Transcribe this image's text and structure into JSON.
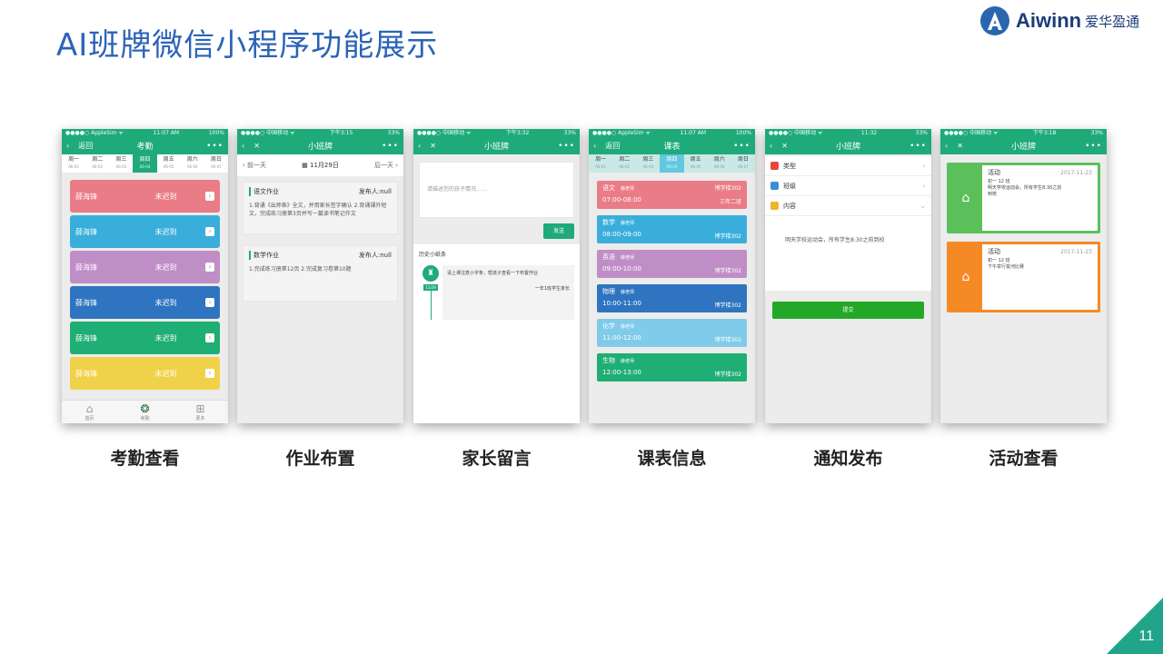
{
  "slide": {
    "title": "AI班牌微信小程序功能展示",
    "page_number": "11",
    "brand_en": "Aiwinn",
    "brand_cn": "爱华盈通"
  },
  "colors": {
    "primary_green": "#1faa7a",
    "title_blue": "#2b63b8"
  },
  "captions": [
    "考勤查看",
    "作业布置",
    "家长留言",
    "课表信息",
    "通知发布",
    "活动查看"
  ],
  "screens": {
    "attendance": {
      "status_left": "●●●●○ AppleSim ᯤ",
      "status_mid": "11:07 AM",
      "status_right": "100%",
      "back": "返回",
      "title": "考勤",
      "more": "•••",
      "days": [
        {
          "label": "周一",
          "date": "06-01"
        },
        {
          "label": "周二",
          "date": "06-02"
        },
        {
          "label": "周三",
          "date": "06-03"
        },
        {
          "label": "周四",
          "date": "06-04"
        },
        {
          "label": "周五",
          "date": "06-05"
        },
        {
          "label": "周六",
          "date": "06-06"
        },
        {
          "label": "周日",
          "date": "06-07"
        }
      ],
      "rows": [
        {
          "name": "薛海锋",
          "status": "未迟到"
        },
        {
          "name": "薛海锋",
          "status": "未迟到"
        },
        {
          "name": "薛海锋",
          "status": "未迟到"
        },
        {
          "name": "薛海锋",
          "status": "未迟到"
        },
        {
          "name": "薛海锋",
          "status": "未迟到"
        },
        {
          "name": "薛海锋",
          "status": "未迟到"
        }
      ],
      "row_colors": [
        "#e97c86",
        "#3aaedb",
        "#c08ec6",
        "#2f74c0",
        "#1fae74",
        "#f0d24a"
      ],
      "tabs": [
        {
          "label": "首页",
          "icon": "⌂"
        },
        {
          "label": "考勤",
          "icon": "❂"
        },
        {
          "label": "更多",
          "icon": "⊞"
        }
      ]
    },
    "homework": {
      "status_left": "●●●●○ 中国移动 ᯤ",
      "status_mid": "下午3:15",
      "status_right": "33%",
      "title": "小班牌",
      "more": "•••",
      "prev": "前一天",
      "date": "11月29日",
      "next": "后一天",
      "cards": [
        {
          "subject": "语文作业",
          "who": "发布人:null",
          "text": "1.背诵《出师表》全文，并用家长签字确认 2.背诵课外短文，完成练习册第3页并写一篇读书笔记作文"
        },
        {
          "subject": "数学作业",
          "who": "发布人:null",
          "text": "1.完成练习册第12页 2.完成复习卷第10题"
        }
      ]
    },
    "message": {
      "status_left": "●●●●○ 中国移动 ᯤ",
      "status_mid": "下午3:32",
      "status_right": "33%",
      "title": "小班牌",
      "more": "•••",
      "placeholder": "请描述您的孩子情况……",
      "send": "发送",
      "history": "历史小纸条",
      "tag": "11/29",
      "note": "请上课注意小字条，帮孩子查看一下布置作业",
      "sign": "一年1班学生家长"
    },
    "schedule": {
      "status_left": "●●●●○ AppleSim ᯤ",
      "status_mid": "11:07 AM",
      "status_right": "100%",
      "back": "返回",
      "title": "课表",
      "more": "•••",
      "days": [
        {
          "label": "周一",
          "date": "06-01"
        },
        {
          "label": "周二",
          "date": "06-02"
        },
        {
          "label": "周三",
          "date": "06-03"
        },
        {
          "label": "周四",
          "date": "06-04"
        },
        {
          "label": "周五",
          "date": "06-05"
        },
        {
          "label": "周六",
          "date": "06-06"
        },
        {
          "label": "周日",
          "date": "06-07"
        }
      ],
      "courses": [
        {
          "subject": "语文",
          "teacher": "薛老师",
          "time": "07:00-08:00",
          "room": "博学楼302",
          "cls": "三年二班"
        },
        {
          "subject": "数学",
          "teacher": "薛老师",
          "time": "08:00-09:00",
          "room": "博学楼302",
          "cls": ""
        },
        {
          "subject": "英语",
          "teacher": "薛老师",
          "time": "09:00-10:00",
          "room": "博学楼302",
          "cls": ""
        },
        {
          "subject": "物理",
          "teacher": "薛老师",
          "time": "10:00-11:00",
          "room": "博学楼302",
          "cls": ""
        },
        {
          "subject": "化学",
          "teacher": "薛老师",
          "time": "11:00-12:00",
          "room": "博学楼302",
          "cls": ""
        },
        {
          "subject": "生物",
          "teacher": "薛老师",
          "time": "12:00-13:00",
          "room": "博学楼302",
          "cls": ""
        }
      ],
      "course_colors": [
        "#e97c86",
        "#3aaedb",
        "#c08ec6",
        "#2f74c0",
        "#7fcbe9",
        "#1fae74"
      ]
    },
    "notice": {
      "status_left": "●●●●○ 中国移动 ᯤ",
      "status_mid": "11:32",
      "status_right": "33%",
      "title": "小班牌",
      "more": "•••",
      "rows": [
        {
          "label": "类型",
          "color": "#e8453c",
          "chev": "›"
        },
        {
          "label": "班级",
          "color": "#3a8fd6",
          "chev": "›"
        },
        {
          "label": "内容",
          "color": "#f0b429",
          "chev": "⌄"
        }
      ],
      "text": "明天学校运动会，所有学生8:30之前到校",
      "submit": "提交"
    },
    "activity": {
      "status_left": "●●●●○ 中国移动 ᯤ",
      "status_mid": "下午3:18",
      "status_right": "33%",
      "title": "小班牌",
      "more": "•••",
      "items": [
        {
          "title": "活动",
          "date": "2017-11-23",
          "l1": "初一 12 班",
          "l2": "明天学校运动会，所有学生8:30之前",
          "l3": "到校",
          "color": "#5cc05a"
        },
        {
          "title": "活动",
          "date": "2017-11-23",
          "l1": "初一 12 班",
          "l2": "下午举行拔河比赛",
          "l3": "",
          "color": "#f58a25"
        }
      ]
    }
  }
}
